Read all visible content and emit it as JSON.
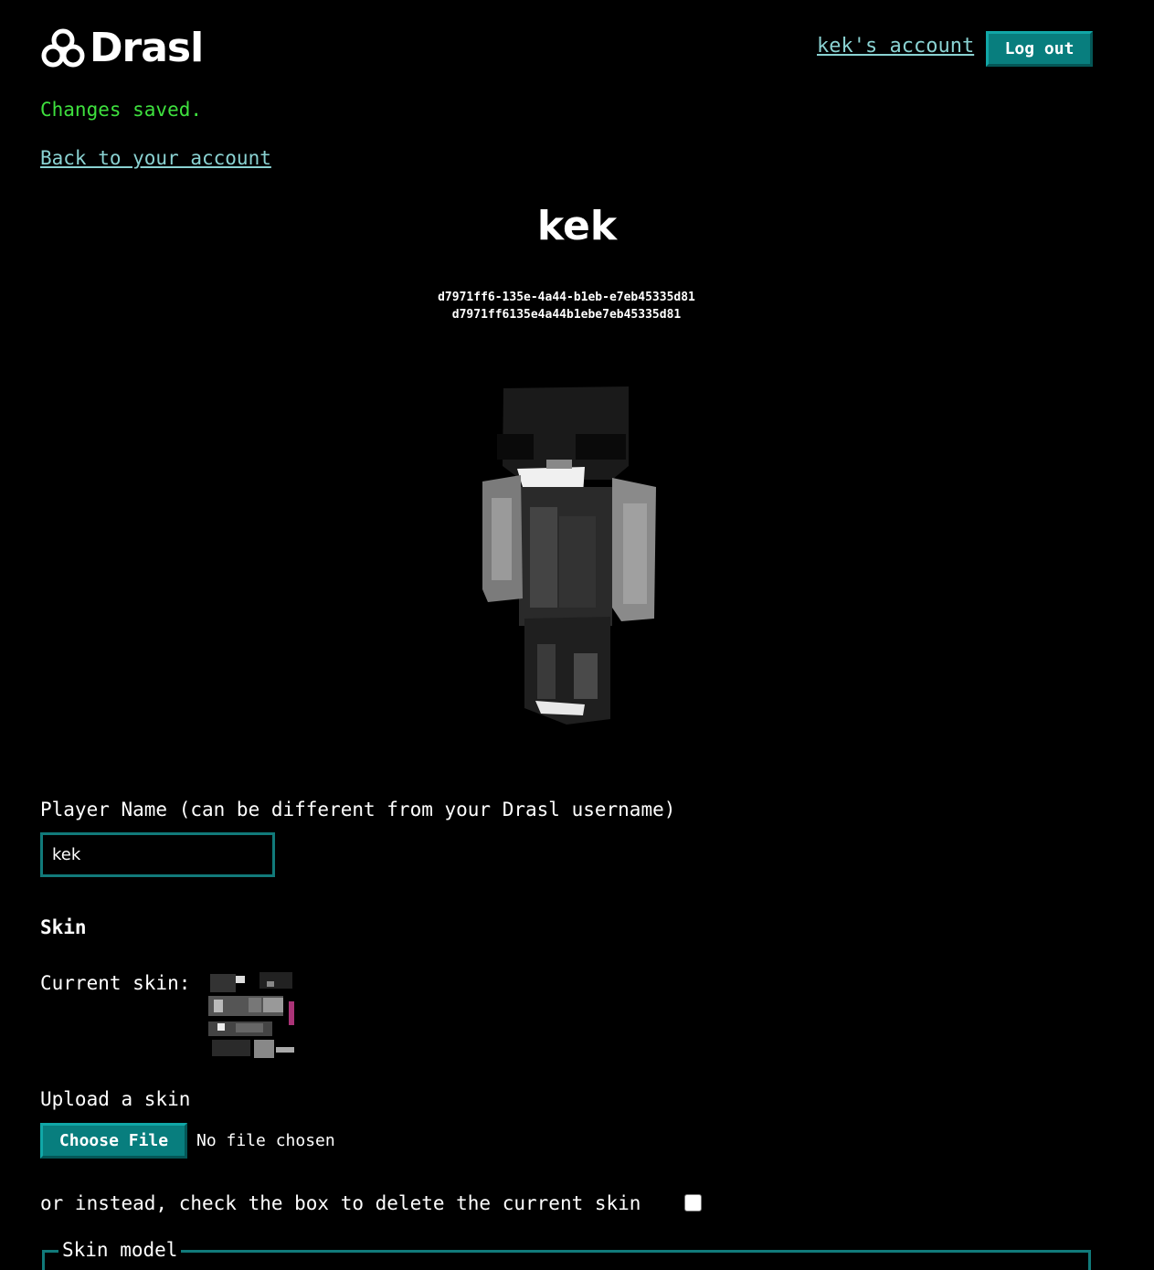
{
  "header": {
    "logo_text": "Drasl",
    "account_link": "kek's account",
    "logout_label": "Log out"
  },
  "flash": {
    "message": "Changes saved."
  },
  "nav": {
    "back_link": "Back to your account"
  },
  "player": {
    "name": "kek",
    "uuid_dashed": "d7971ff6-135e-4a44-b1eb-e7eb45335d81",
    "uuid_plain": "d7971ff6135e4a44b1ebe7eb45335d81"
  },
  "form": {
    "player_name_label": "Player Name (can be different from your Drasl username)",
    "player_name_value": "kek",
    "skin_heading": "Skin",
    "current_skin_label": "Current skin:",
    "upload_label": "Upload a skin",
    "choose_file_label": "Choose File",
    "no_file_text": "No file chosen",
    "delete_label": "or instead, check the box to delete the current skin",
    "skin_model_legend": "Skin model"
  },
  "colors": {
    "accent": "#087e7e",
    "link": "#8ad2d2",
    "success": "#3ee03e",
    "background": "#000000"
  }
}
